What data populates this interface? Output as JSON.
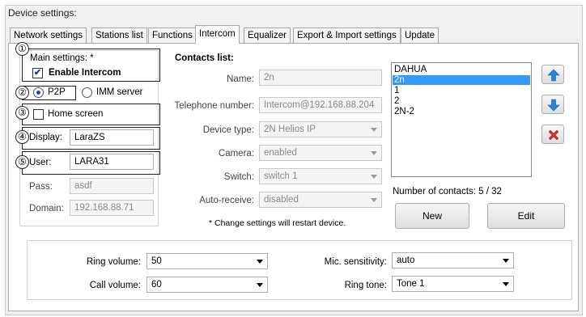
{
  "window": {
    "title": "Device settings:"
  },
  "tabs": [
    {
      "label": "Network settings"
    },
    {
      "label": "Stations list"
    },
    {
      "label": "Functions"
    },
    {
      "label": "Intercom",
      "active": true
    },
    {
      "label": "Equalizer"
    },
    {
      "label": "Export & Import settings"
    },
    {
      "label": "Update"
    }
  ],
  "annotations": [
    "①",
    "②",
    "③",
    "④",
    "⑤"
  ],
  "main_settings": {
    "label": "Main settings: *",
    "enable_intercom": {
      "label": "Enable Intercom",
      "checked": true
    },
    "mode_p2p": {
      "label": "P2P",
      "selected": true
    },
    "mode_imm": {
      "label": "IMM server",
      "selected": false
    },
    "home_screen": {
      "label": "Home screen",
      "checked": false
    },
    "display": {
      "label": "Display:",
      "value": "LaraZS"
    },
    "user": {
      "label": "User:",
      "value": "LARA31"
    },
    "pass": {
      "label": "Pass:",
      "value": "asdf"
    },
    "domain": {
      "label": "Domain:",
      "value": "192.168.88.71"
    }
  },
  "contacts": {
    "title": "Contacts list:",
    "name": {
      "label": "Name:",
      "value": "2n"
    },
    "telephone": {
      "label": "Telephone number:",
      "value": "Intercom@192.168.88.204"
    },
    "device_type": {
      "label": "Device type:",
      "value": "2N Helios IP"
    },
    "camera": {
      "label": "Camera:",
      "value": "enabled"
    },
    "switch": {
      "label": "Switch:",
      "value": "switch 1"
    },
    "auto_receive": {
      "label": "Auto-receive:",
      "value": "disabled"
    },
    "note": "* Change settings will restart device.",
    "list": [
      "DAHUA",
      "2n",
      "1",
      "2",
      "2N-2"
    ],
    "selected_index": 1,
    "count_label": "Number of contacts: 5 / 32",
    "new_button": "New",
    "edit_button": "Edit",
    "up_icon": "arrow-up-icon",
    "down_icon": "arrow-down-icon",
    "delete_icon": "delete-x-icon"
  },
  "audio": {
    "ring_volume": {
      "label": "Ring volume:",
      "value": "50"
    },
    "call_volume": {
      "label": "Call volume:",
      "value": "60"
    },
    "mic_sensitivity": {
      "label": "Mic. sensitivity:",
      "value": "auto"
    },
    "ring_tone": {
      "label": "Ring tone:",
      "value": "Tone 1"
    }
  },
  "colors": {
    "accent": "#3399ff",
    "arrow_blue": "#2b84d3",
    "delete_red": "#d62c2c"
  }
}
